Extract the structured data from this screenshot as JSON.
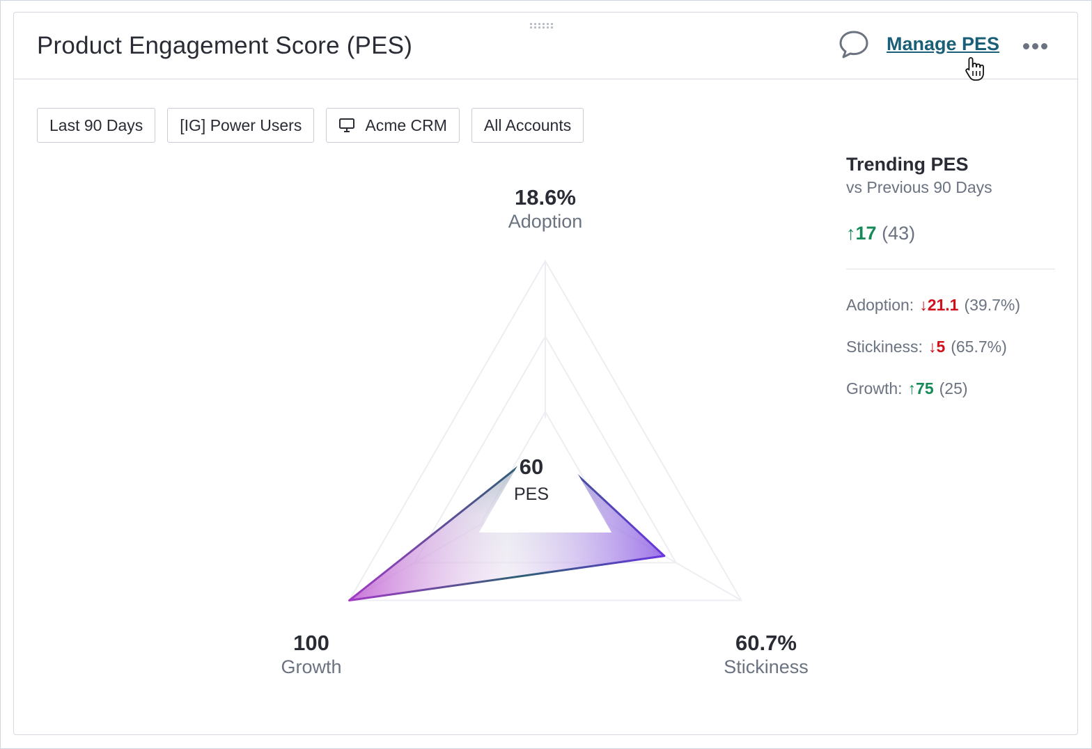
{
  "header": {
    "title": "Product Engagement Score (PES)",
    "manage_label": "Manage PES"
  },
  "filters": [
    {
      "label": "Last 90 Days",
      "icon": null
    },
    {
      "label": "[IG] Power Users",
      "icon": null
    },
    {
      "label": "Acme CRM",
      "icon": "monitor-icon"
    },
    {
      "label": "All Accounts",
      "icon": null
    }
  ],
  "chart_data": {
    "type": "radar",
    "score": {
      "value": "60",
      "label": "PES"
    },
    "axes": [
      {
        "name": "Adoption",
        "display": "18.6%",
        "normalized": 18.6
      },
      {
        "name": "Stickiness",
        "display": "60.7%",
        "normalized": 60.7
      },
      {
        "name": "Growth",
        "display": "100",
        "normalized": 100
      }
    ],
    "range": [
      0,
      100
    ],
    "colors": {
      "top": "#2d5f73",
      "right": "#7b3fe4",
      "left": "#b33cc9"
    }
  },
  "trending": {
    "title": "Trending PES",
    "subtitle": "vs Previous 90 Days",
    "total": {
      "direction": "up",
      "arrow": "↑",
      "delta": "17",
      "previous": "(43)"
    },
    "metrics": [
      {
        "label": "Adoption:",
        "direction": "down",
        "arrow": "↓",
        "delta": "21.1",
        "previous": "(39.7%)"
      },
      {
        "label": "Stickiness:",
        "direction": "down",
        "arrow": "↓",
        "delta": "5",
        "previous": "(65.7%)"
      },
      {
        "label": "Growth:",
        "direction": "up",
        "arrow": "↑",
        "delta": "75",
        "previous": "(25)"
      }
    ]
  }
}
